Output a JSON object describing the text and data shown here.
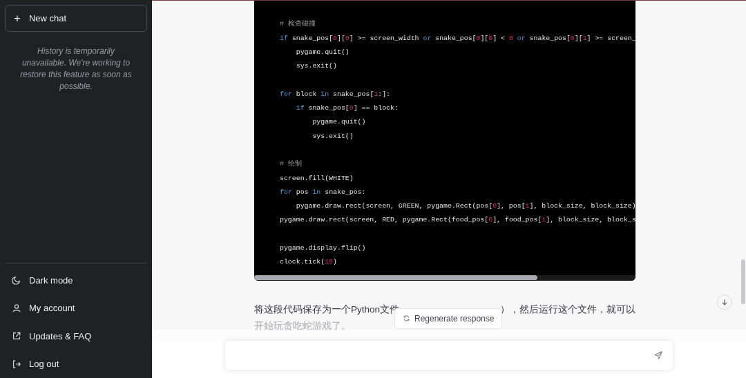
{
  "sidebar": {
    "new_chat": {
      "icon": "+",
      "label": "New chat"
    },
    "history_notice": "History is temporarily unavailable. We're working to restore this feature as soon as possible.",
    "menu": [
      {
        "kind": "moon",
        "label": "Dark mode"
      },
      {
        "kind": "user",
        "label": "My account"
      },
      {
        "kind": "external",
        "label": "Updates & FAQ"
      },
      {
        "kind": "logout",
        "label": "Log out"
      }
    ]
  },
  "code_block": {
    "groups": [
      {
        "lines": [
          [
            {
              "t": "# 检查碰撞",
              "kind": "comment"
            }
          ],
          [
            {
              "t": "if",
              "kind": "kw"
            },
            {
              "t": " snake_pos[",
              "kind": "plain"
            },
            {
              "t": "0",
              "kind": "num"
            },
            {
              "t": "][",
              "kind": "plain"
            },
            {
              "t": "0",
              "kind": "num"
            },
            {
              "t": "] >= screen_width ",
              "kind": "plain"
            },
            {
              "t": "or",
              "kind": "kw"
            },
            {
              "t": " snake_pos[",
              "kind": "plain"
            },
            {
              "t": "0",
              "kind": "num"
            },
            {
              "t": "][",
              "kind": "plain"
            },
            {
              "t": "0",
              "kind": "num"
            },
            {
              "t": "] < ",
              "kind": "plain"
            },
            {
              "t": "0",
              "kind": "num"
            },
            {
              "t": " or",
              "kind": "kw"
            },
            {
              "t": " snake_pos[",
              "kind": "plain"
            },
            {
              "t": "0",
              "kind": "num"
            },
            {
              "t": "][",
              "kind": "plain"
            },
            {
              "t": "1",
              "kind": "num"
            },
            {
              "t": "] >= screen_",
              "kind": "plain"
            }
          ],
          [
            {
              "t": "    pygame.quit()",
              "kind": "plain"
            }
          ],
          [
            {
              "t": "    sys.exit()",
              "kind": "plain"
            }
          ]
        ]
      },
      {
        "lines": [
          [
            {
              "t": "for",
              "kind": "kw"
            },
            {
              "t": " block ",
              "kind": "plain"
            },
            {
              "t": "in",
              "kind": "kw"
            },
            {
              "t": " snake_pos[",
              "kind": "plain"
            },
            {
              "t": "1",
              "kind": "num"
            },
            {
              "t": ":]:",
              "kind": "plain"
            }
          ],
          [
            {
              "t": "    if",
              "kind": "kw"
            },
            {
              "t": " snake_pos[",
              "kind": "plain"
            },
            {
              "t": "0",
              "kind": "num"
            },
            {
              "t": "] == block:",
              "kind": "plain"
            }
          ],
          [
            {
              "t": "        pygame.quit()",
              "kind": "plain"
            }
          ],
          [
            {
              "t": "        sys.exit()",
              "kind": "plain"
            }
          ]
        ]
      },
      {
        "lines": [
          [
            {
              "t": "# 绘制",
              "kind": "comment"
            }
          ],
          [
            {
              "t": "screen.fill(WHITE)",
              "kind": "plain"
            }
          ],
          [
            {
              "t": "for",
              "kind": "kw"
            },
            {
              "t": " pos ",
              "kind": "plain"
            },
            {
              "t": "in",
              "kind": "kw"
            },
            {
              "t": " snake_pos:",
              "kind": "plain"
            }
          ],
          [
            {
              "t": "    pygame.draw.rect(screen, GREEN, pygame.Rect(pos[",
              "kind": "plain"
            },
            {
              "t": "0",
              "kind": "num"
            },
            {
              "t": "], pos[",
              "kind": "plain"
            },
            {
              "t": "1",
              "kind": "num"
            },
            {
              "t": "], block_size, block_size)",
              "kind": "plain"
            }
          ],
          [
            {
              "t": "pygame.draw.rect(screen, RED, pygame.Rect(food_pos[",
              "kind": "plain"
            },
            {
              "t": "0",
              "kind": "num"
            },
            {
              "t": "], food_pos[",
              "kind": "plain"
            },
            {
              "t": "1",
              "kind": "num"
            },
            {
              "t": "], block_size, block_s",
              "kind": "plain"
            }
          ]
        ]
      },
      {
        "lines": [
          [
            {
              "t": "pygame.display.flip()",
              "kind": "plain"
            }
          ],
          [
            {
              "t": "clock.tick(",
              "kind": "plain"
            },
            {
              "t": "10",
              "kind": "num"
            },
            {
              "t": ")",
              "kind": "plain"
            }
          ]
        ]
      }
    ]
  },
  "answer": {
    "line_1_start": "将这段代码保存为一个Python文件",
    "line_1_end": "），然后运行这个文件，就可以",
    "line_2": "开始玩贪吃蛇游戏了。"
  },
  "regenerate_button": {
    "label": "Regenerate response"
  }
}
